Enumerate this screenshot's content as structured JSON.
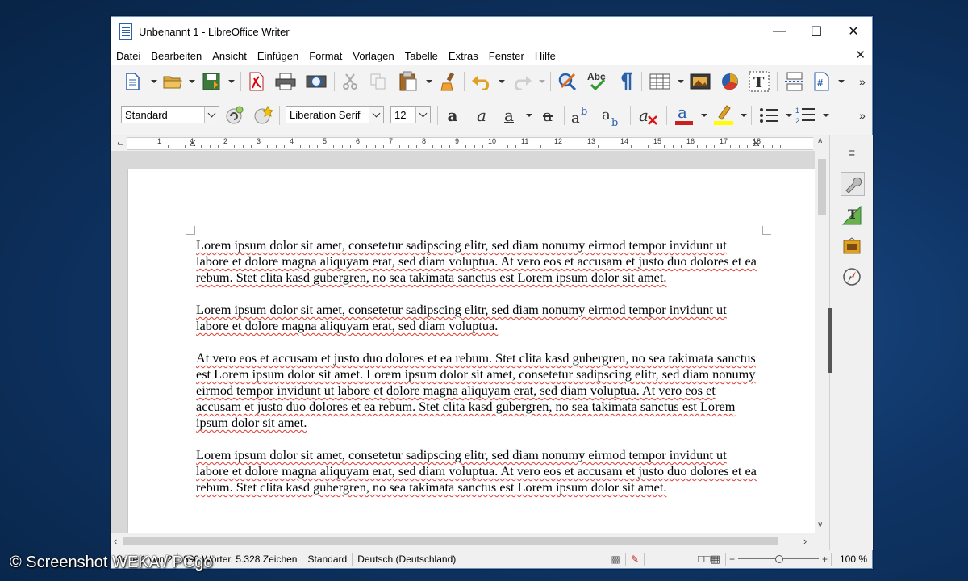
{
  "window": {
    "title": "Unbenannt 1 - LibreOffice Writer"
  },
  "menu": [
    "Datei",
    "Bearbeiten",
    "Ansicht",
    "Einfügen",
    "Format",
    "Vorlagen",
    "Tabelle",
    "Extras",
    "Fenster",
    "Hilfe"
  ],
  "formatting": {
    "paragraph_style": "Standard",
    "font_name": "Liberation Serif",
    "font_size": "12"
  },
  "document": {
    "paragraphs": [
      "Lorem ipsum dolor sit amet, consetetur sadipscing elitr, sed diam nonumy eirmod tempor invidunt ut labore et dolore magna aliquyam erat, sed diam voluptua. At vero eos et accusam et justo duo dolores et ea rebum. Stet clita kasd gubergren, no sea takimata sanctus est Lorem ipsum dolor sit amet.",
      "Lorem ipsum dolor sit amet, consetetur sadipscing elitr, sed diam nonumy eirmod tempor invidunt ut labore et dolore magna aliquyam erat, sed diam voluptua.",
      "At vero eos et accusam et justo duo dolores et ea rebum. Stet clita kasd gubergren, no sea takimata sanctus est Lorem ipsum dolor sit amet. Lorem ipsum dolor sit amet, consetetur sadipscing elitr, sed diam nonumy eirmod tempor invidunt ut labore et dolore magna aliquyam erat, sed diam voluptua. At vero eos et accusam et justo duo dolores et ea rebum. Stet clita kasd gubergren, no sea takimata sanctus est Lorem ipsum dolor sit amet.",
      "Lorem ipsum dolor sit amet, consetetur sadipscing elitr, sed diam nonumy eirmod tempor invidunt ut labore et dolore magna aliquyam erat, sed diam voluptua. At vero eos et accusam et justo duo dolores et ea rebum. Stet clita kasd gubergren, no sea takimata sanctus est Lorem ipsum dolor sit amet."
    ]
  },
  "ruler": [
    "1",
    "1",
    "2",
    "3",
    "4",
    "5",
    "6",
    "7",
    "8",
    "9",
    "10",
    "11",
    "12",
    "13",
    "14",
    "15",
    "16",
    "17",
    "18"
  ],
  "status": {
    "page": "Seite 1 von 2",
    "words": "890 Wörter, 5.328 Zeichen",
    "style": "Standard",
    "language": "Deutsch (Deutschland)",
    "zoom": "100 %"
  },
  "watermark": "© Screenshot WEKA / PCgo",
  "colors": {
    "font_color": "#c9211e",
    "highlight_color": "#ffff00",
    "spell_underline": "#e2392b"
  }
}
